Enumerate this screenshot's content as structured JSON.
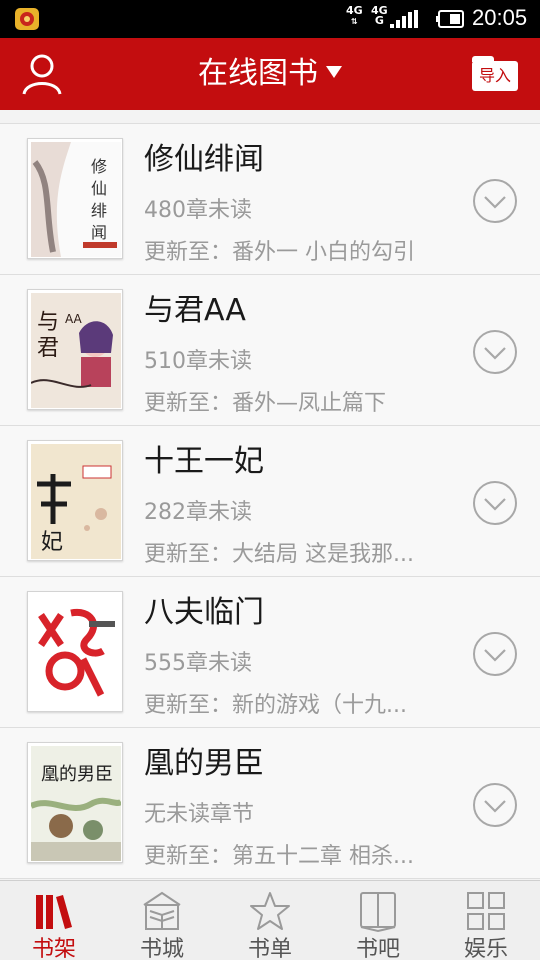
{
  "status_bar": {
    "network1": "4G",
    "network2": "4G",
    "network2_sub": "G",
    "time": "20:05"
  },
  "header": {
    "title": "在线图书",
    "import_label": "导入"
  },
  "books": [
    {
      "title": "修仙绯闻",
      "unread": "480章未读",
      "update": "更新至：番外一 小白的勾引",
      "cover_text": "修仙绯闻"
    },
    {
      "title": "与君AA",
      "unread": "510章未读",
      "update": "更新至：番外—凤止篇下",
      "cover_text": "与君AA"
    },
    {
      "title": "十王一妃",
      "unread": "282章未读",
      "update": "更新至：大结局 这是我那...",
      "cover_text": "十王一妃"
    },
    {
      "title": "八夫临门",
      "unread": "555章未读",
      "update": "更新至：新的游戏（十九...",
      "cover_text": "八夫临门"
    },
    {
      "title": "凰的男臣",
      "unread": "无未读章节",
      "update": "更新至：第五十二章 相杀...",
      "cover_text": "凰的男臣"
    }
  ],
  "bottom_nav": [
    {
      "label": "书架",
      "icon": "bookshelf-icon",
      "active": true
    },
    {
      "label": "书城",
      "icon": "bookstore-icon",
      "active": false
    },
    {
      "label": "书单",
      "icon": "star-icon",
      "active": false
    },
    {
      "label": "书吧",
      "icon": "open-book-icon",
      "active": false
    },
    {
      "label": "娱乐",
      "icon": "grid-icon",
      "active": false
    }
  ],
  "colors": {
    "brand_red": "#c30d0f",
    "muted_text": "#9a9a9a"
  }
}
